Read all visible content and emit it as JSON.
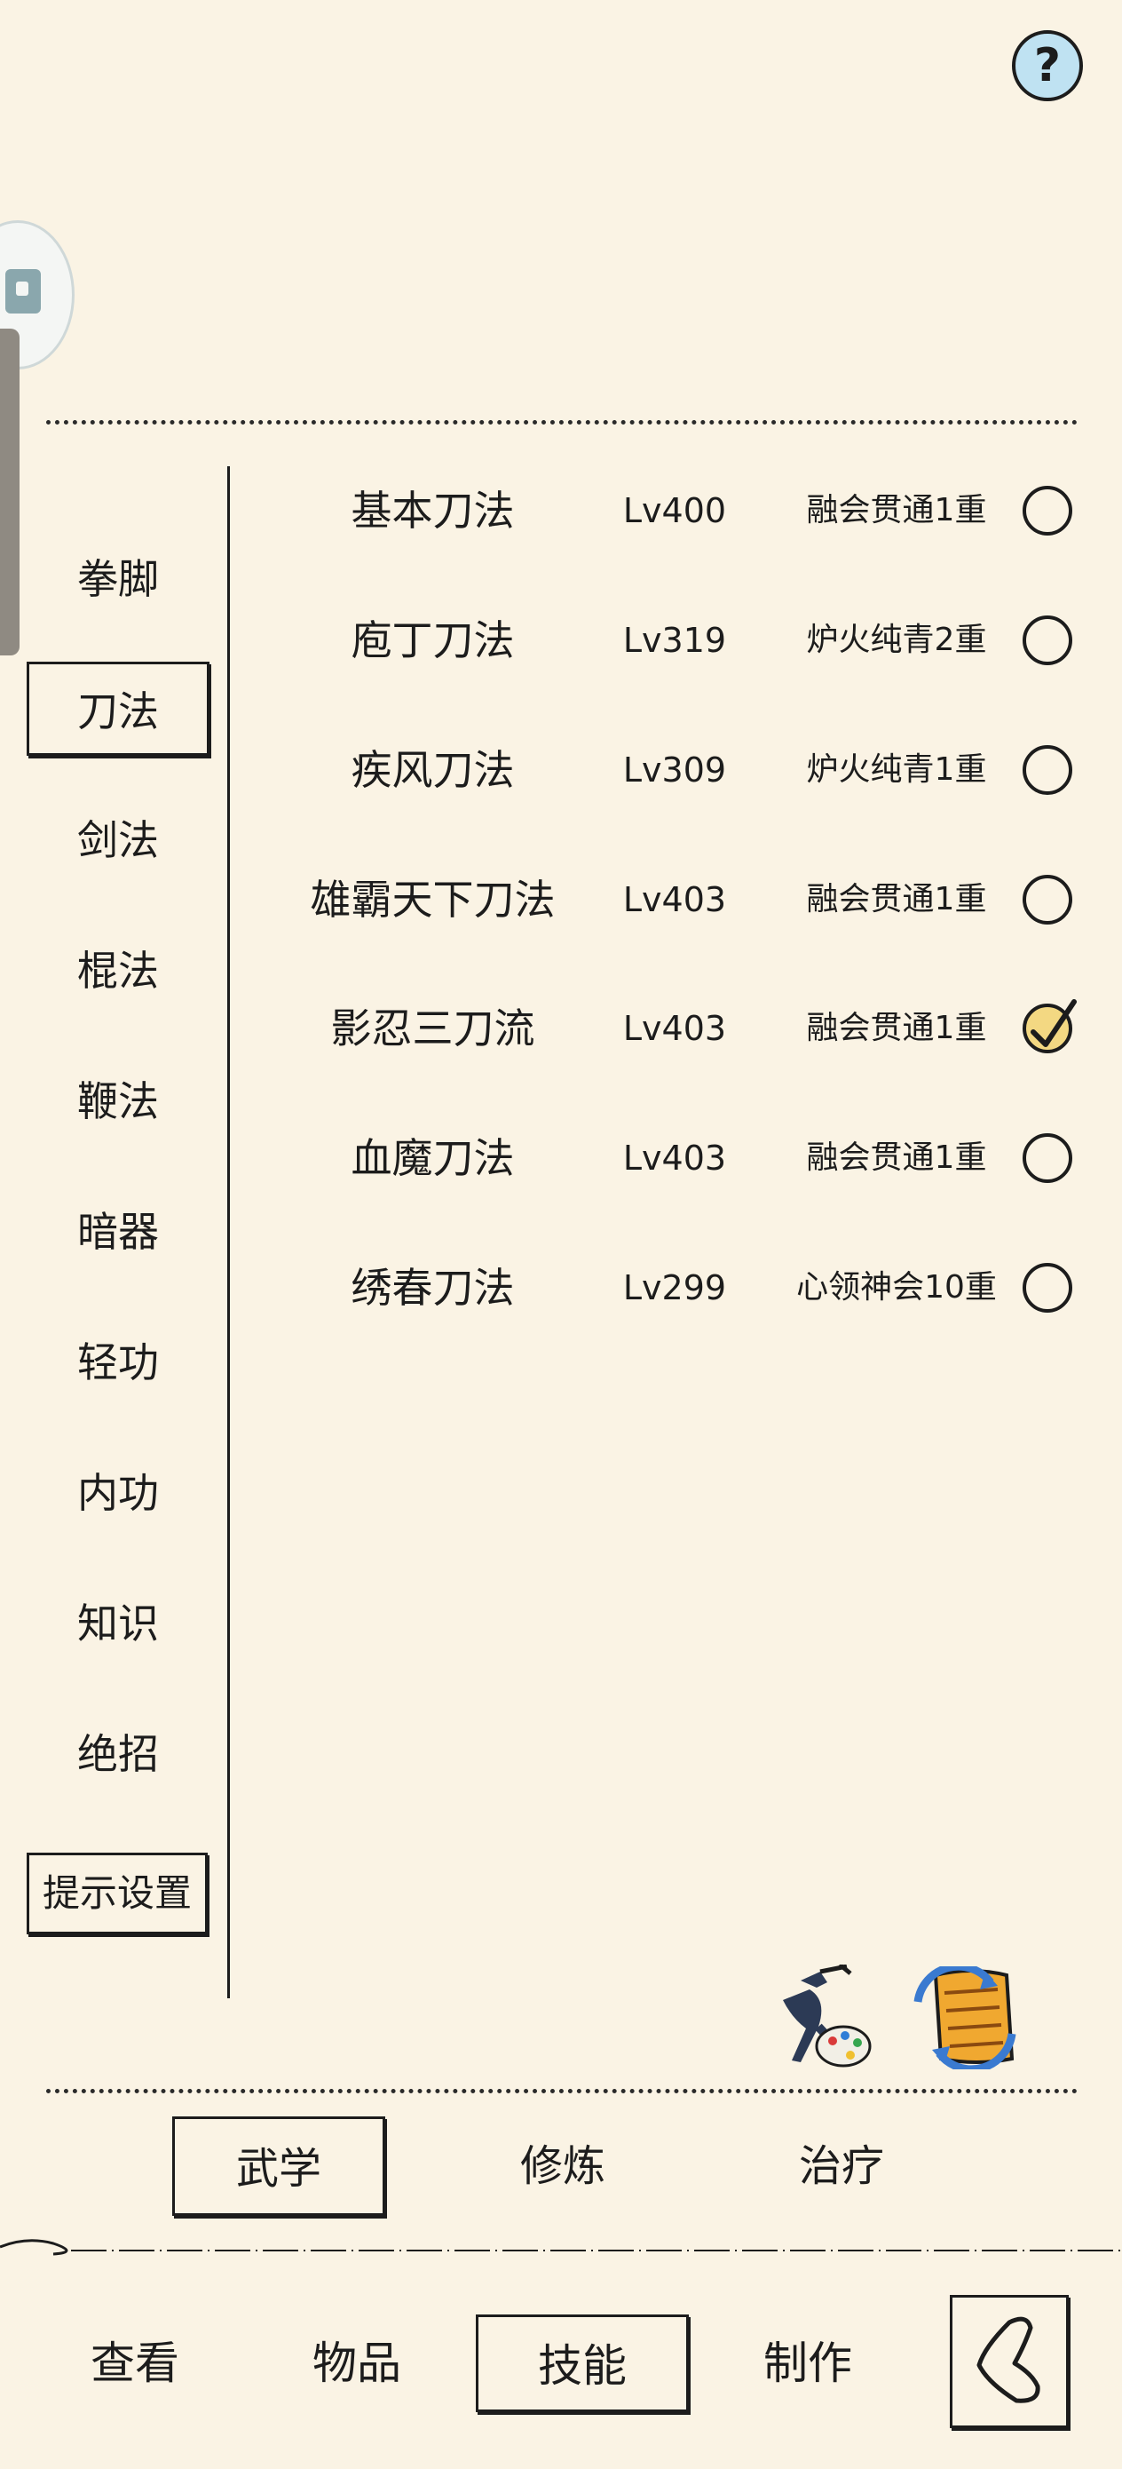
{
  "header": {
    "help_label": "?"
  },
  "categories": [
    {
      "label": "拳脚"
    },
    {
      "label": "刀法"
    },
    {
      "label": "剑法"
    },
    {
      "label": "棍法"
    },
    {
      "label": "鞭法"
    },
    {
      "label": "暗器"
    },
    {
      "label": "轻功"
    },
    {
      "label": "内功"
    },
    {
      "label": "知识"
    },
    {
      "label": "绝招"
    }
  ],
  "active_category": "刀法",
  "hint_settings_label": "提示设置",
  "skills": [
    {
      "name": "基本刀法",
      "level": "Lv400",
      "rank": "融会贯通1重",
      "selected": false
    },
    {
      "name": "庖丁刀法",
      "level": "Lv319",
      "rank": "炉火纯青2重",
      "selected": false
    },
    {
      "name": "疾风刀法",
      "level": "Lv309",
      "rank": "炉火纯青1重",
      "selected": false
    },
    {
      "name": "雄霸天下刀法",
      "level": "Lv403",
      "rank": "融会贯通1重",
      "selected": false
    },
    {
      "name": "影忍三刀流",
      "level": "Lv403",
      "rank": "融会贯通1重",
      "selected": true
    },
    {
      "name": "血魔刀法",
      "level": "Lv403",
      "rank": "融会贯通1重",
      "selected": false
    },
    {
      "name": "绣春刀法",
      "level": "Lv299",
      "rank": "心领神会10重",
      "selected": false
    }
  ],
  "sub_tabs": [
    {
      "label": "武学",
      "active": true
    },
    {
      "label": "修炼",
      "active": false
    },
    {
      "label": "治疗",
      "active": false
    }
  ],
  "bottom_nav": [
    {
      "label": "查看",
      "active": false
    },
    {
      "label": "物品",
      "active": false
    },
    {
      "label": "技能",
      "active": true
    },
    {
      "label": "制作",
      "active": false
    }
  ],
  "icons": {
    "help": "question-mark-icon",
    "floating": "floating-ball-icon",
    "ninja": "ninja-palette-icon",
    "scroll": "scroll-refresh-icon",
    "back": "back-chevron-icon",
    "check": "check-icon"
  },
  "colors": {
    "background": "#faf3e4",
    "ink": "#1c1c1c",
    "selected_radio": "#f3d882",
    "help_bg": "#bfe2f2"
  }
}
